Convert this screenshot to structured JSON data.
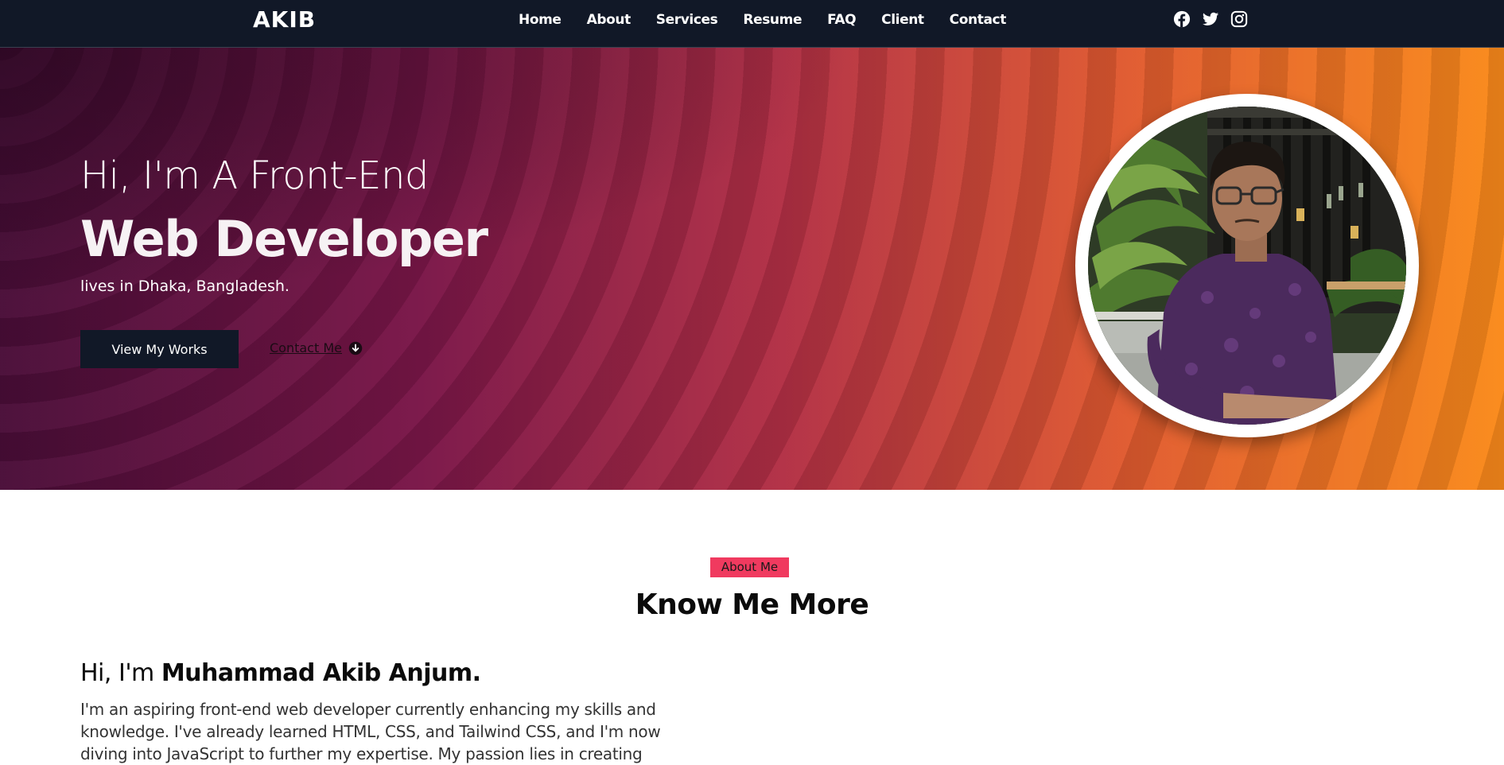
{
  "brand": {
    "logo": "AKIB"
  },
  "nav": {
    "links": [
      "Home",
      "About",
      "Services",
      "Resume",
      "FAQ",
      "Client",
      "Contact"
    ]
  },
  "socials": [
    "facebook-icon",
    "twitter-icon",
    "instagram-icon"
  ],
  "hero": {
    "intro": "Hi, I'm A Front-End",
    "title": "Web Developer",
    "location": "lives in Dhaka, Bangladesh.",
    "primary_button": "View My Works",
    "secondary_link": "Contact Me",
    "colors": {
      "start": "#4a0d38",
      "mid": "#b22f45",
      "end": "#fa8a1a"
    }
  },
  "about": {
    "badge": "About Me",
    "title": "Know Me More",
    "greeting_prefix": "Hi, I'm ",
    "name": "Muhammad Akib Anjum.",
    "body": "I'm an aspiring front-end web developer currently enhancing my skills and knowledge. I've already learned HTML, CSS, and Tailwind CSS, and I'm now diving into JavaScript to further my expertise. My passion lies in creating"
  },
  "colors": {
    "navbar": "#111827",
    "badge": "#f03a5f",
    "button": "#111827"
  }
}
